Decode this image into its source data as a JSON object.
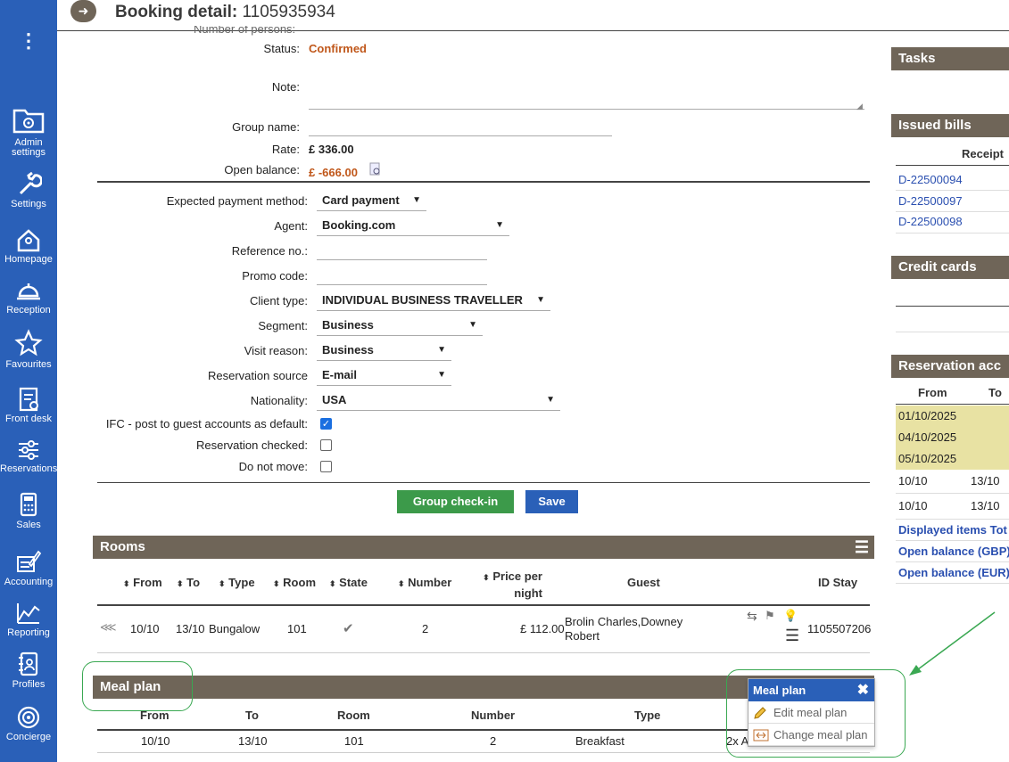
{
  "header": {
    "title_bold": "Booking detail:",
    "booking_id": "1105935934"
  },
  "sidebar": {
    "items": [
      {
        "label": "Admin\nsettings",
        "icon": "folder-gear-icon"
      },
      {
        "label": "Settings",
        "icon": "wrench-icon"
      },
      {
        "label": "Homepage",
        "icon": "home-icon"
      },
      {
        "label": "Reception",
        "icon": "bell-icon"
      },
      {
        "label": "Favourites",
        "icon": "star-icon"
      },
      {
        "label": "Front desk",
        "icon": "clipboard-icon"
      },
      {
        "label": "Reservations",
        "icon": "sliders-icon"
      },
      {
        "label": "Sales",
        "icon": "calculator-icon"
      },
      {
        "label": "Accounting",
        "icon": "pen-icon"
      },
      {
        "label": "Reporting",
        "icon": "chart-icon"
      },
      {
        "label": "Profiles",
        "icon": "profile-book-icon"
      },
      {
        "label": "Concierge",
        "icon": "concierge-icon"
      }
    ]
  },
  "form": {
    "cut_label": "Number of persons:",
    "status_label": "Status:",
    "status_value": "Confirmed",
    "note_label": "Note:",
    "group_name_label": "Group name:",
    "rate_label": "Rate:",
    "rate_value": "£ 336.00",
    "open_balance_label": "Open balance:",
    "open_balance_value": "£ -666.00",
    "payment_label": "Expected payment method:",
    "payment_value": "Card payment",
    "agent_label": "Agent:",
    "agent_value": "Booking.com",
    "reference_label": "Reference no.:",
    "promo_label": "Promo code:",
    "client_type_label": "Client type:",
    "client_type_value": "INDIVIDUAL BUSINESS TRAVELLER",
    "segment_label": "Segment:",
    "segment_value": "Business",
    "visit_label": "Visit reason:",
    "visit_value": "Business",
    "source_label": "Reservation source",
    "source_value": "E-mail",
    "nationality_label": "Nationality:",
    "nationality_value": "USA",
    "ifc_label": "IFC - post to guest accounts as default:",
    "checked_label": "Reservation checked:",
    "donotmove_label": "Do not move:",
    "group_checkin_btn": "Group check-in",
    "save_btn": "Save"
  },
  "rooms": {
    "title": "Rooms",
    "headers": {
      "from": "From",
      "to": "To",
      "type": "Type",
      "room": "Room",
      "state": "State",
      "number": "Number",
      "price1": "Price per",
      "price2": "night",
      "guest": "Guest",
      "id_stay": "ID Stay"
    },
    "row": {
      "from": "10/10",
      "to": "13/10",
      "type": "Bungalow",
      "room": "101",
      "number": "2",
      "price": "£ 112.00",
      "guest1": "Brolin Charles,Downey",
      "guest2": "Robert",
      "id_stay": "1105507206"
    }
  },
  "meal_plan": {
    "title": "Meal plan",
    "headers": {
      "from": "From",
      "to": "To",
      "room": "Room",
      "number": "Number",
      "type": "Type"
    },
    "row": {
      "from": "10/10",
      "to": "13/10",
      "room": "101",
      "number": "2",
      "type": "Breakfast",
      "extra": "2x A"
    }
  },
  "popup": {
    "title": "Meal plan",
    "edit": "Edit meal plan",
    "change": "Change meal plan"
  },
  "right": {
    "tasks": "Tasks",
    "issued_bills": "Issued bills",
    "receipt_header": "Receipt",
    "bills": [
      "D-22500094",
      "D-22500097",
      "D-22500098"
    ],
    "credit_cards": "Credit cards",
    "reservation_acc": "Reservation acc",
    "from_header": "From",
    "to_header": "To",
    "acc_dates": [
      "01/10/2025",
      "04/10/2025",
      "05/10/2025"
    ],
    "acc_rows": [
      {
        "from": "10/10",
        "to": "13/10"
      },
      {
        "from": "10/10",
        "to": "13/10"
      }
    ],
    "displayed": "Displayed items Tot",
    "ob_gbp": "Open balance (GBP)",
    "ob_eur": "Open balance (EUR)"
  },
  "colors": {
    "sidebar": "#2a60b8",
    "section": "#6f6558",
    "accent_orange": "#c0571a",
    "green": "#3c9a4a"
  }
}
